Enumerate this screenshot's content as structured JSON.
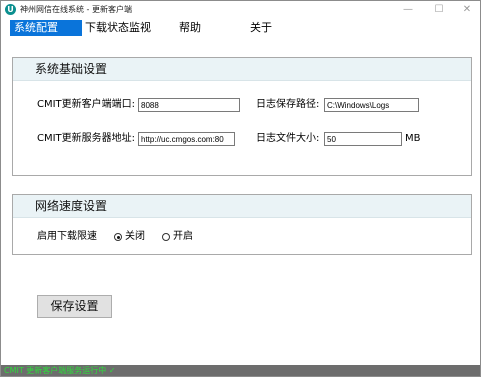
{
  "window": {
    "title": "神州网信在线系统 - 更新客户端",
    "icon_letter": "U",
    "min_symbol": "—",
    "max_symbol": "☐",
    "close_symbol": "✕"
  },
  "menu": {
    "items": [
      {
        "label": "系统配置",
        "active": true
      },
      {
        "label": "下载状态监视",
        "active": false
      },
      {
        "label": "帮助",
        "active": false
      },
      {
        "label": "关于",
        "active": false
      }
    ]
  },
  "basic_settings": {
    "title": "系统基础设置",
    "client_port_label": "CMIT更新客户端端口:",
    "client_port_value": "8088",
    "server_addr_label": "CMIT更新服务器地址:",
    "server_addr_value": "http://uc.cmgos.com:80",
    "log_path_label": "日志保存路径:",
    "log_path_value": "C:\\Windows\\Logs",
    "log_size_label": "日志文件大小:",
    "log_size_value": "50",
    "log_size_unit": "MB"
  },
  "network_settings": {
    "title": "网络速度设置",
    "limit_label": "启用下载限速",
    "option_off": "关闭",
    "option_on": "开启",
    "selected": "关闭"
  },
  "actions": {
    "save_label": "保存设置"
  },
  "status": {
    "text": "CMIT 更新客户端服务运行中 ✓"
  },
  "colors": {
    "menu_active": "#0a74da",
    "group_header_bg": "#eaf3f6",
    "status_bar_bg": "#6d6d6d",
    "status_text": "#2ddc3a",
    "app_icon": "#0b8f8f"
  }
}
